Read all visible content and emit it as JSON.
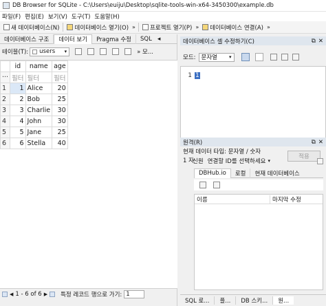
{
  "window": {
    "title": "DB Browser for SQLite - C:\\Users\\euiju\\Desktop\\sqlite-tools-win-x64-3450300\\example.db"
  },
  "menu": [
    "파일(F)",
    "편집(E)",
    "보기(V)",
    "도구(T)",
    "도움말(H)"
  ],
  "toolbar": {
    "new_db": "새 데이터베이스(N)",
    "open_db": "데이터베이스 열기(O)",
    "overflow": "»",
    "open_project": "프로젝트 열기(P)",
    "attach_db": "데이터베이스 연결(A)"
  },
  "tabs": [
    "데이터베이스 구조",
    "데이터 보기",
    "Pragma 수정",
    "SQL"
  ],
  "tabs_overflow": "◂",
  "browse": {
    "table_label": "테이블(T):",
    "table_value": "users",
    "overflow": "» 모...",
    "columns": [
      "id",
      "name",
      "age"
    ],
    "filter_row_num": "···",
    "filter_placeholder": "필터",
    "rows": [
      {
        "n": "1",
        "id": "1",
        "name": "Alice",
        "age": "20"
      },
      {
        "n": "2",
        "id": "2",
        "name": "Bob",
        "age": "25"
      },
      {
        "n": "3",
        "id": "3",
        "name": "Charlie",
        "age": "30"
      },
      {
        "n": "4",
        "id": "4",
        "name": "John",
        "age": "30"
      },
      {
        "n": "5",
        "id": "5",
        "name": "Jane",
        "age": "25"
      },
      {
        "n": "6",
        "id": "6",
        "name": "Stella",
        "age": "40"
      }
    ],
    "status_range": "1 - 6 of 6",
    "goto_label": "특정 레코드 행으로 가기:",
    "goto_value": "1"
  },
  "edit_cell": {
    "title": "데이터베이스 셀 수정하기(C)",
    "mode_label": "모드:",
    "mode_value": "문자열",
    "line_number": "1",
    "cell_value": "1",
    "type_label": "현재 데이터 타입: 문자열 / 숫자",
    "size_label": "1 자",
    "apply_button": "적용"
  },
  "remote": {
    "title": "원격(R)",
    "identity_label": "신원",
    "identity_placeholder": "연결할 ID를 선택하세요",
    "tabs": [
      "DBHub.io",
      "로컬",
      "현재 데이터베이스"
    ],
    "columns": [
      "이름",
      "마지막 수정"
    ]
  },
  "bottom_tabs": [
    "SQL 로...",
    "플...",
    "DB 스키...",
    "원..."
  ],
  "panel_buttons": {
    "float": "⧉",
    "close": "✕"
  }
}
